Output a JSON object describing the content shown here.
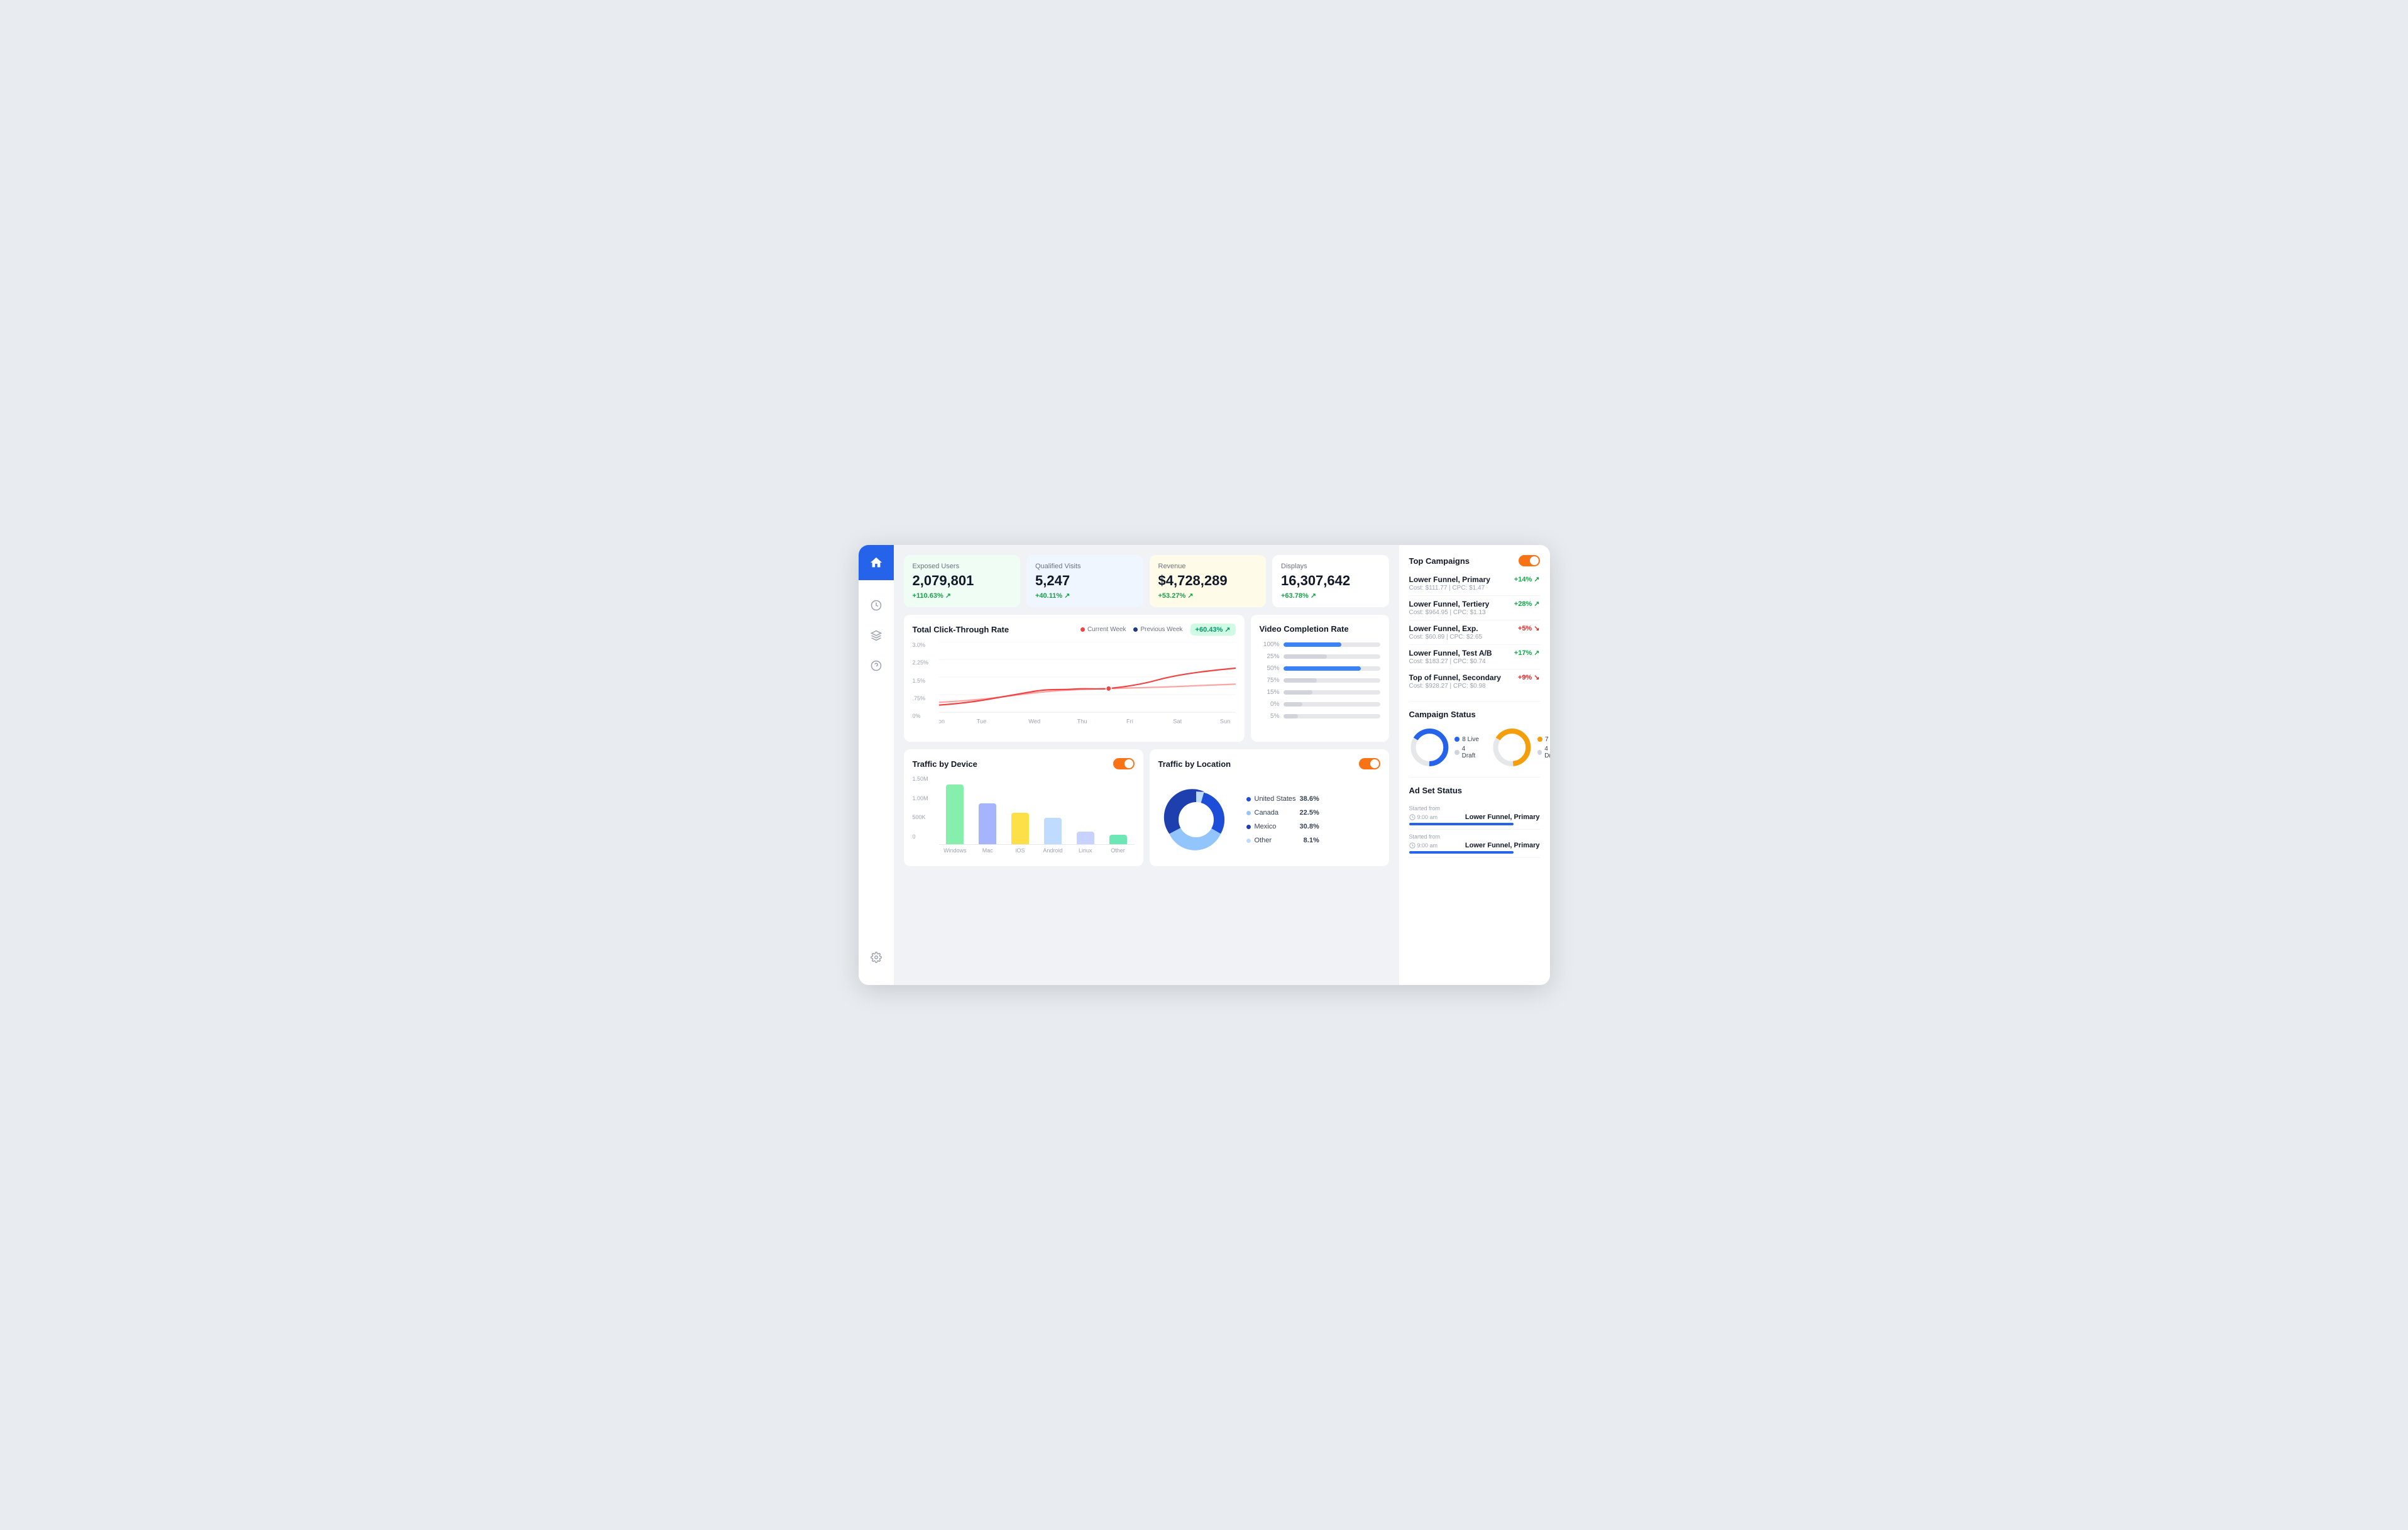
{
  "sidebar": {
    "icons": [
      {
        "name": "home-icon",
        "symbol": "⌂",
        "active": true
      },
      {
        "name": "clock-icon",
        "symbol": "◔",
        "active": false
      },
      {
        "name": "layers-icon",
        "symbol": "◈",
        "active": false
      },
      {
        "name": "help-icon",
        "symbol": "?",
        "active": false
      },
      {
        "name": "settings-icon",
        "symbol": "✦",
        "active": false
      }
    ]
  },
  "stats": [
    {
      "id": "exposed",
      "label": "Exposed Users",
      "value": "2,079,801",
      "change": "+110.63%",
      "positive": true,
      "theme": "green"
    },
    {
      "id": "visits",
      "label": "Qualified Visits",
      "value": "5,247",
      "change": "+40.11%",
      "positive": true,
      "theme": "blue"
    },
    {
      "id": "revenue",
      "label": "Revenue",
      "value": "$4,728,289",
      "change": "+53.27%",
      "positive": true,
      "theme": "yellow"
    },
    {
      "id": "displays",
      "label": "Displays",
      "value": "16,307,642",
      "change": "+63.78%",
      "positive": true,
      "theme": "white"
    }
  ],
  "ctr_chart": {
    "title": "Total Click-Through Rate",
    "legend": {
      "current": "Current Week",
      "previous": "Previous Week"
    },
    "badge": "+60.43%",
    "x_labels": [
      "Mon",
      "Tue",
      "Wed",
      "Thu",
      "Fri",
      "Sat",
      "Sun"
    ],
    "y_labels": [
      "3.0%",
      "2.25%",
      "1.5%",
      ".75%",
      "0%"
    ]
  },
  "video_chart": {
    "title": "Video Completion Rate",
    "bars": [
      {
        "label": "100%",
        "pct": 60,
        "color": "#3b82f6"
      },
      {
        "label": "25%",
        "pct": 45,
        "color": "#d1d5db"
      },
      {
        "label": "50%",
        "pct": 80,
        "color": "#d1d5db"
      },
      {
        "label": "75%",
        "pct": 35,
        "color": "#d1d5db"
      },
      {
        "label": "15%",
        "pct": 30,
        "color": "#d1d5db"
      },
      {
        "label": "0%",
        "pct": 20,
        "color": "#d1d5db"
      },
      {
        "label": "5%",
        "pct": 15,
        "color": "#d1d5db"
      }
    ]
  },
  "device_chart": {
    "title": "Traffic by Device",
    "y_labels": [
      "1.50M",
      "1.00M",
      "500K",
      "0"
    ],
    "bars": [
      {
        "label": "Windows",
        "height": 95,
        "color": "#86efac"
      },
      {
        "label": "Mac",
        "height": 65,
        "color": "#a5b4fc"
      },
      {
        "label": "iOS",
        "height": 50,
        "color": "#fde047"
      },
      {
        "label": "Android",
        "height": 42,
        "color": "#bfdbfe"
      },
      {
        "label": "Linux",
        "height": 20,
        "color": "#c7d2fe"
      },
      {
        "label": "Other",
        "height": 15,
        "color": "#6ee7b7"
      }
    ]
  },
  "location_chart": {
    "title": "Traffic by Location",
    "items": [
      {
        "name": "United States",
        "pct": "38.6%",
        "color": "#1d4ed8"
      },
      {
        "name": "Canada",
        "pct": "22.5%",
        "color": "#60a5fa"
      },
      {
        "name": "Mexico",
        "pct": "30.8%",
        "color": "#1e40af"
      },
      {
        "name": "Other",
        "pct": "8.1%",
        "color": "#93c5fd"
      }
    ]
  },
  "top_campaigns": {
    "title": "Top Campaigns",
    "items": [
      {
        "name": "Lower Funnel, Primary",
        "cost": "$111.77",
        "cpc": "$1.47",
        "change": "+14%",
        "positive": true
      },
      {
        "name": "Lower Funnel, Tertiery",
        "cost": "$964.95",
        "cpc": "$1.13",
        "change": "+28%",
        "positive": true
      },
      {
        "name": "Lower Funnel, Exp.",
        "cost": "$60.89",
        "cpc": "$2.65",
        "change": "+5%",
        "positive": false
      },
      {
        "name": "Lower Funnel, Test A/B",
        "cost": "$183.27",
        "cpc": "$0.74",
        "change": "+17%",
        "positive": true
      },
      {
        "name": "Top of Funnel, Secondary",
        "cost": "$928.27",
        "cpc": "$0.98",
        "change": "+9%",
        "positive": false
      }
    ]
  },
  "campaign_status": {
    "title": "Campaign Status",
    "left": {
      "live": 8,
      "draft": 4,
      "color": "#2563eb"
    },
    "right": {
      "live": 7,
      "draft": 4,
      "color": "#f59e0b"
    },
    "live_label": "Live",
    "draft_label": "Draft"
  },
  "ad_set_status": {
    "title": "Ad Set Status",
    "items": [
      {
        "label": "Started from",
        "time": "9:00 am",
        "name": "Lower Funnel, Primary"
      },
      {
        "label": "Started from",
        "time": "9:00 am",
        "name": "Lower Funnel, Primary"
      }
    ]
  }
}
